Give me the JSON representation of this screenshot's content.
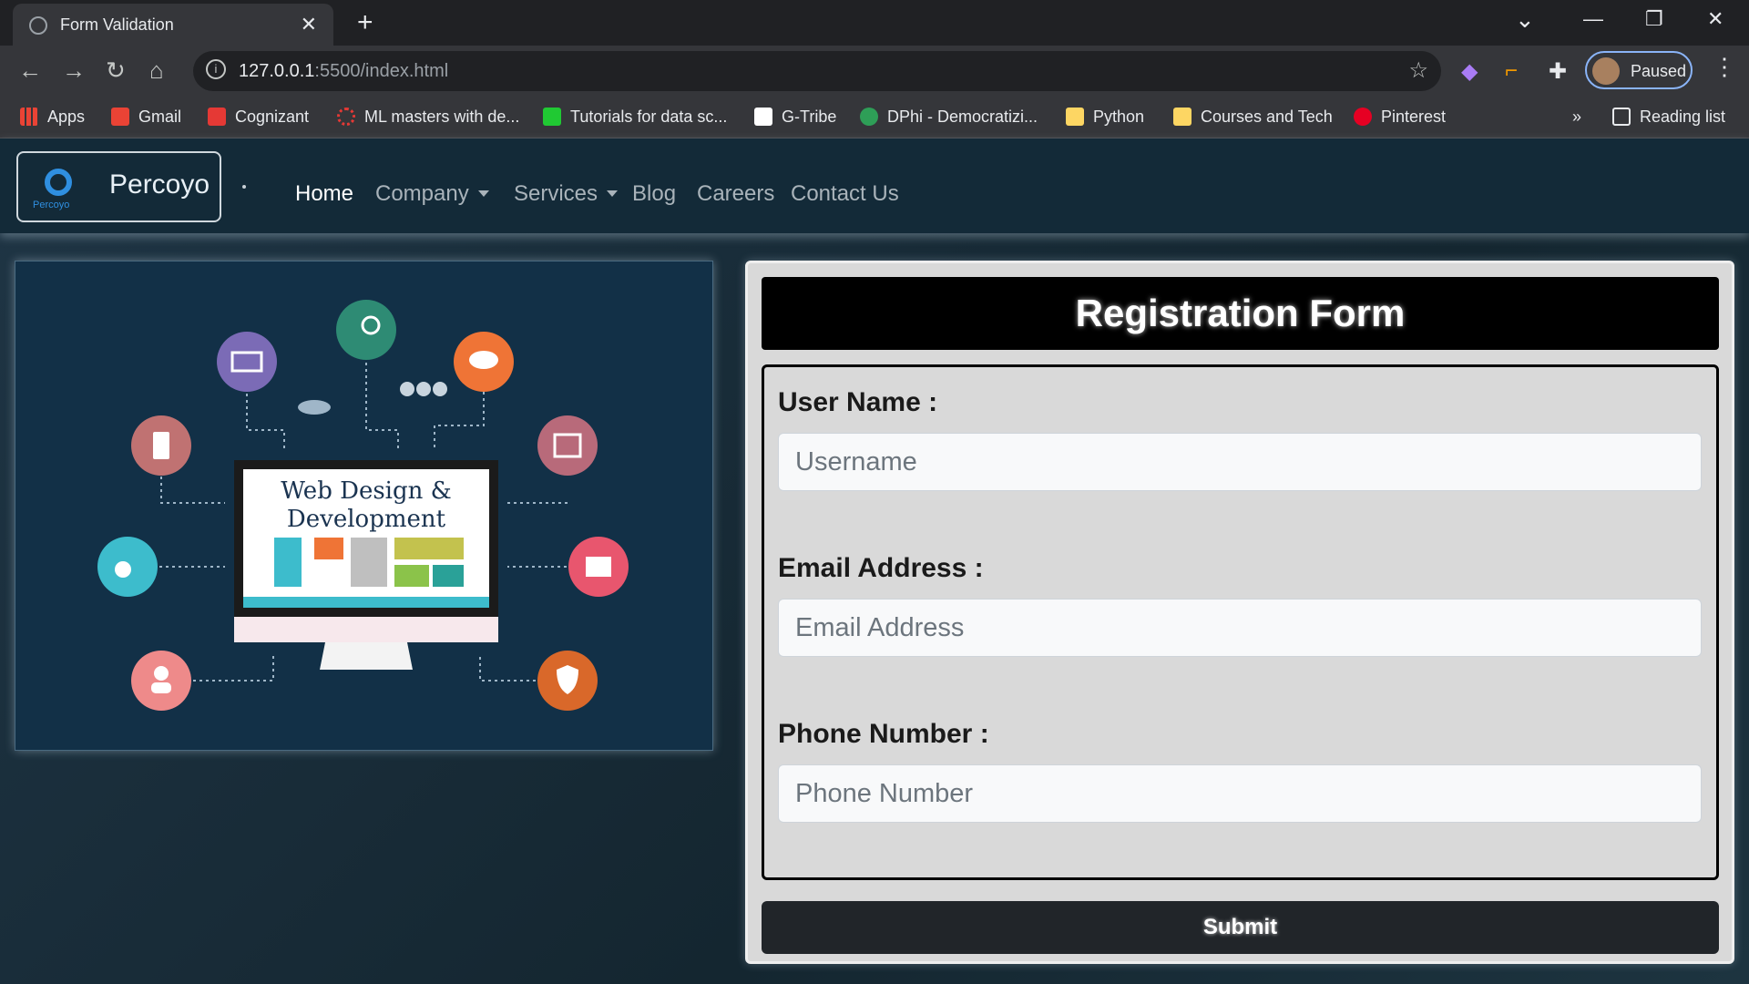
{
  "browser": {
    "tab_title": "Form Validation",
    "tab_close": "✕",
    "new_tab": "+",
    "window_controls": [
      "—",
      "❐",
      "✕"
    ],
    "url_host": "127.0.0.1",
    "url_path": ":5500/index.html",
    "profile_label": "Paused",
    "bookmarks": [
      {
        "label": "Apps",
        "icon": "apps-grid-icon",
        "color": "#ea4335"
      },
      {
        "label": "Gmail",
        "icon": "gmail-icon",
        "color": "#ea4335"
      },
      {
        "label": "Cognizant",
        "icon": "cognizant-icon",
        "color": "#e53935"
      },
      {
        "label": "ML masters with de...",
        "icon": "ml-masters-icon",
        "color": "#e53935"
      },
      {
        "label": "Tutorials for data sc...",
        "icon": "tutorials-icon",
        "color": "#20c933"
      },
      {
        "label": "G-Tribe",
        "icon": "g-tribe-icon",
        "color": "#ffffff"
      },
      {
        "label": "DPhi - Democratizi...",
        "icon": "dphi-icon",
        "color": "#2e9e57"
      },
      {
        "label": "Python",
        "icon": "folder-icon",
        "color": "#fdd663"
      },
      {
        "label": "Courses and Tech",
        "icon": "folder-icon",
        "color": "#fdd663"
      },
      {
        "label": "Pinterest",
        "icon": "pinterest-icon",
        "color": "#e60023"
      }
    ],
    "more": "»",
    "reading_list": "Reading list"
  },
  "navbar": {
    "brand": "Percoyo",
    "items": [
      {
        "label": "Home",
        "active": true,
        "dropdown": false
      },
      {
        "label": "Company",
        "active": false,
        "dropdown": true
      },
      {
        "label": "Services",
        "active": false,
        "dropdown": true
      },
      {
        "label": "Blog",
        "active": false,
        "dropdown": false
      },
      {
        "label": "Careers",
        "active": false,
        "dropdown": false
      },
      {
        "label": "Contact Us",
        "active": false,
        "dropdown": false
      }
    ]
  },
  "illustration": {
    "title_line1": "Web Design &",
    "title_line2": "Development"
  },
  "form": {
    "title": "Registration Form",
    "username_label": "User Name :",
    "username_placeholder": "Username",
    "email_label": "Email Address :",
    "email_placeholder": "Email Address",
    "phone_label": "Phone Number :",
    "phone_placeholder": "Phone Number",
    "submit_label": "Submit"
  },
  "colors": {
    "browser_bg": "#202124",
    "navbar_bg": "#132a38",
    "form_bg": "#d9d9d9",
    "form_header_bg": "#000000",
    "submit_bg": "#212529"
  }
}
